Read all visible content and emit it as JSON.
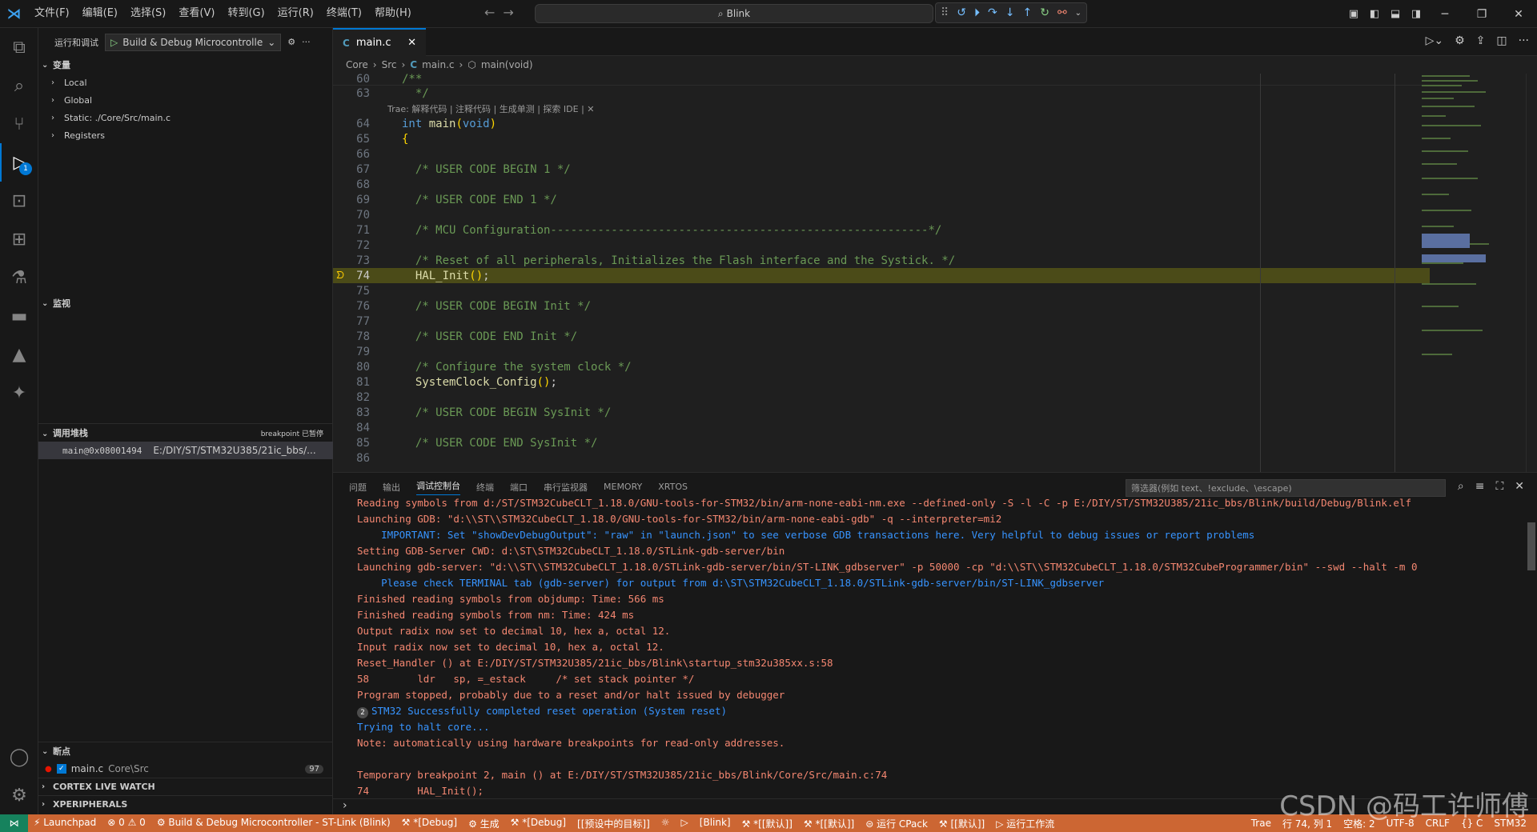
{
  "titlebar": {
    "menu": [
      "文件(F)",
      "编辑(E)",
      "选择(S)",
      "查看(V)",
      "转到(G)",
      "运行(R)",
      "终端(T)",
      "帮助(H)"
    ],
    "search_text": "Blink"
  },
  "sidebar": {
    "header_title": "运行和调试",
    "launch_config": "Build & Debug Microcontrolle",
    "variables_title": "变量",
    "variables": [
      "Local",
      "Global",
      "Static: ./Core/Src/main.c",
      "Registers"
    ],
    "watch_title": "监视",
    "callstack_title": "调用堆栈",
    "callstack_status": "breakpoint 已暂停",
    "callstack_frame": "main@0x08001494",
    "callstack_path": "E:/DIY/ST/STM32U385/21ic_bbs/...",
    "breakpoints_title": "断点",
    "breakpoint_file": "main.c",
    "breakpoint_dir": "Core\\Src",
    "breakpoint_count": "97",
    "cortex_live_watch": "CORTEX LIVE WATCH",
    "xperipherals": "XPERIPHERALS"
  },
  "activity_badge": "1",
  "editor": {
    "tab_label": "main.c",
    "breadcrumb": [
      "Core",
      "Src",
      "main.c",
      "main(void)"
    ],
    "codelens": "Trae: 解释代码 | 注释代码 | 生成单测 | 探索 IDE | ✕",
    "sticky_line_no": "60",
    "sticky_text": "/**",
    "lines": [
      {
        "no": "63",
        "text": "  */",
        "cls": "cm"
      },
      {
        "no": "64",
        "text": "int main(void)",
        "cls": "sig"
      },
      {
        "no": "65",
        "text": "{",
        "cls": "br"
      },
      {
        "no": "66",
        "text": "",
        "cls": ""
      },
      {
        "no": "67",
        "text": "  /* USER CODE BEGIN 1 */",
        "cls": "cm"
      },
      {
        "no": "68",
        "text": "",
        "cls": ""
      },
      {
        "no": "69",
        "text": "  /* USER CODE END 1 */",
        "cls": "cm"
      },
      {
        "no": "70",
        "text": "",
        "cls": ""
      },
      {
        "no": "71",
        "text": "  /* MCU Configuration--------------------------------------------------------*/",
        "cls": "cm"
      },
      {
        "no": "72",
        "text": "",
        "cls": ""
      },
      {
        "no": "73",
        "text": "  /* Reset of all peripherals, Initializes the Flash interface and the Systick. */",
        "cls": "cm"
      },
      {
        "no": "74",
        "text": "  HAL_Init();",
        "cls": "call"
      },
      {
        "no": "75",
        "text": "",
        "cls": ""
      },
      {
        "no": "76",
        "text": "  /* USER CODE BEGIN Init */",
        "cls": "cm"
      },
      {
        "no": "77",
        "text": "",
        "cls": ""
      },
      {
        "no": "78",
        "text": "  /* USER CODE END Init */",
        "cls": "cm"
      },
      {
        "no": "79",
        "text": "",
        "cls": ""
      },
      {
        "no": "80",
        "text": "  /* Configure the system clock */",
        "cls": "cm"
      },
      {
        "no": "81",
        "text": "  SystemClock_Config();",
        "cls": "call"
      },
      {
        "no": "82",
        "text": "",
        "cls": ""
      },
      {
        "no": "83",
        "text": "  /* USER CODE BEGIN SysInit */",
        "cls": "cm"
      },
      {
        "no": "84",
        "text": "",
        "cls": ""
      },
      {
        "no": "85",
        "text": "  /* USER CODE END SysInit */",
        "cls": "cm"
      },
      {
        "no": "86",
        "text": "",
        "cls": ""
      }
    ]
  },
  "panel": {
    "tabs": [
      "问题",
      "输出",
      "调试控制台",
      "终端",
      "端口",
      "串行监视器",
      "MEMORY",
      "XRTOS"
    ],
    "filter_placeholder": "筛选器(例如 text、!exclude、\\escape)",
    "console": [
      {
        "text": "Reading symbols from d:/ST/STM32CubeCLT_1.18.0/GNU-tools-for-STM32/bin/arm-none-eabi-nm.exe --defined-only -S -l -C -p E:/DIY/ST/STM32U385/21ic_bbs/Blink/build/Debug/Blink.elf",
        "color": "red"
      },
      {
        "text": "Launching GDB: \"d:\\\\ST\\\\STM32CubeCLT_1.18.0/GNU-tools-for-STM32/bin/arm-none-eabi-gdb\" -q --interpreter=mi2",
        "color": "red"
      },
      {
        "text": "    IMPORTANT: Set \"showDevDebugOutput\": \"raw\" in \"launch.json\" to see verbose GDB transactions here. Very helpful to debug issues or report problems",
        "color": "blue"
      },
      {
        "text": "Setting GDB-Server CWD: d:\\ST\\STM32CubeCLT_1.18.0/STLink-gdb-server/bin",
        "color": "red"
      },
      {
        "text": "Launching gdb-server: \"d:\\\\ST\\\\STM32CubeCLT_1.18.0/STLink-gdb-server/bin/ST-LINK_gdbserver\" -p 50000 -cp \"d:\\\\ST\\\\STM32CubeCLT_1.18.0/STM32CubeProgrammer/bin\" --swd --halt -m 0",
        "color": "red"
      },
      {
        "text": "    Please check TERMINAL tab (gdb-server) for output from d:\\ST\\STM32CubeCLT_1.18.0/STLink-gdb-server/bin/ST-LINK_gdbserver",
        "color": "blue"
      },
      {
        "text": "Finished reading symbols from objdump: Time: 566 ms",
        "color": "red"
      },
      {
        "text": "Finished reading symbols from nm: Time: 424 ms",
        "color": "red"
      },
      {
        "text": "Output radix now set to decimal 10, hex a, octal 12.",
        "color": "red"
      },
      {
        "text": "Input radix now set to decimal 10, hex a, octal 12.",
        "color": "red"
      },
      {
        "text": "Reset_Handler () at E:/DIY/ST/STM32U385/21ic_bbs/Blink\\startup_stm32u385xx.s:58",
        "color": "red"
      },
      {
        "text": "58        ldr   sp, =_estack     /* set stack pointer */",
        "color": "red"
      },
      {
        "text": "Program stopped, probably due to a reset and/or halt issued by debugger",
        "color": "red"
      },
      {
        "text": "STM32 Successfully completed reset operation (System reset)",
        "color": "blue",
        "badge": "2"
      },
      {
        "text": "Trying to halt core...",
        "color": "blue"
      },
      {
        "text": "Note: automatically using hardware breakpoints for read-only addresses.",
        "color": "red"
      },
      {
        "text": "",
        "color": "red"
      },
      {
        "text": "Temporary breakpoint 2, main () at E:/DIY/ST/STM32U385/21ic_bbs/Blink/Core/Src/main.c:74",
        "color": "red"
      },
      {
        "text": "74        HAL_Init();",
        "color": "red"
      }
    ]
  },
  "statusbar": {
    "left": [
      "⚡ Launchpad",
      "⊗ 0 ⚠ 0",
      "⚙ Build & Debug Microcontroller - ST-Link (Blink)",
      "⚒ *[Debug]",
      "⚙ 生成",
      "⚒ *[Debug]",
      "[[预设中的目标]]",
      "☼",
      "▷",
      "[Blink]",
      "⚒ *[[默认]]",
      "⚒ *[[默认]]",
      "⊜ 运行 CPack",
      "⚒ [[默认]]",
      "▷ 运行工作流"
    ],
    "right": [
      "Trae",
      "行 74, 列 1",
      "空格: 2",
      "UTF-8",
      "CRLF",
      "{} C",
      "STM32"
    ]
  },
  "watermark": "CSDN @码工许师傅"
}
